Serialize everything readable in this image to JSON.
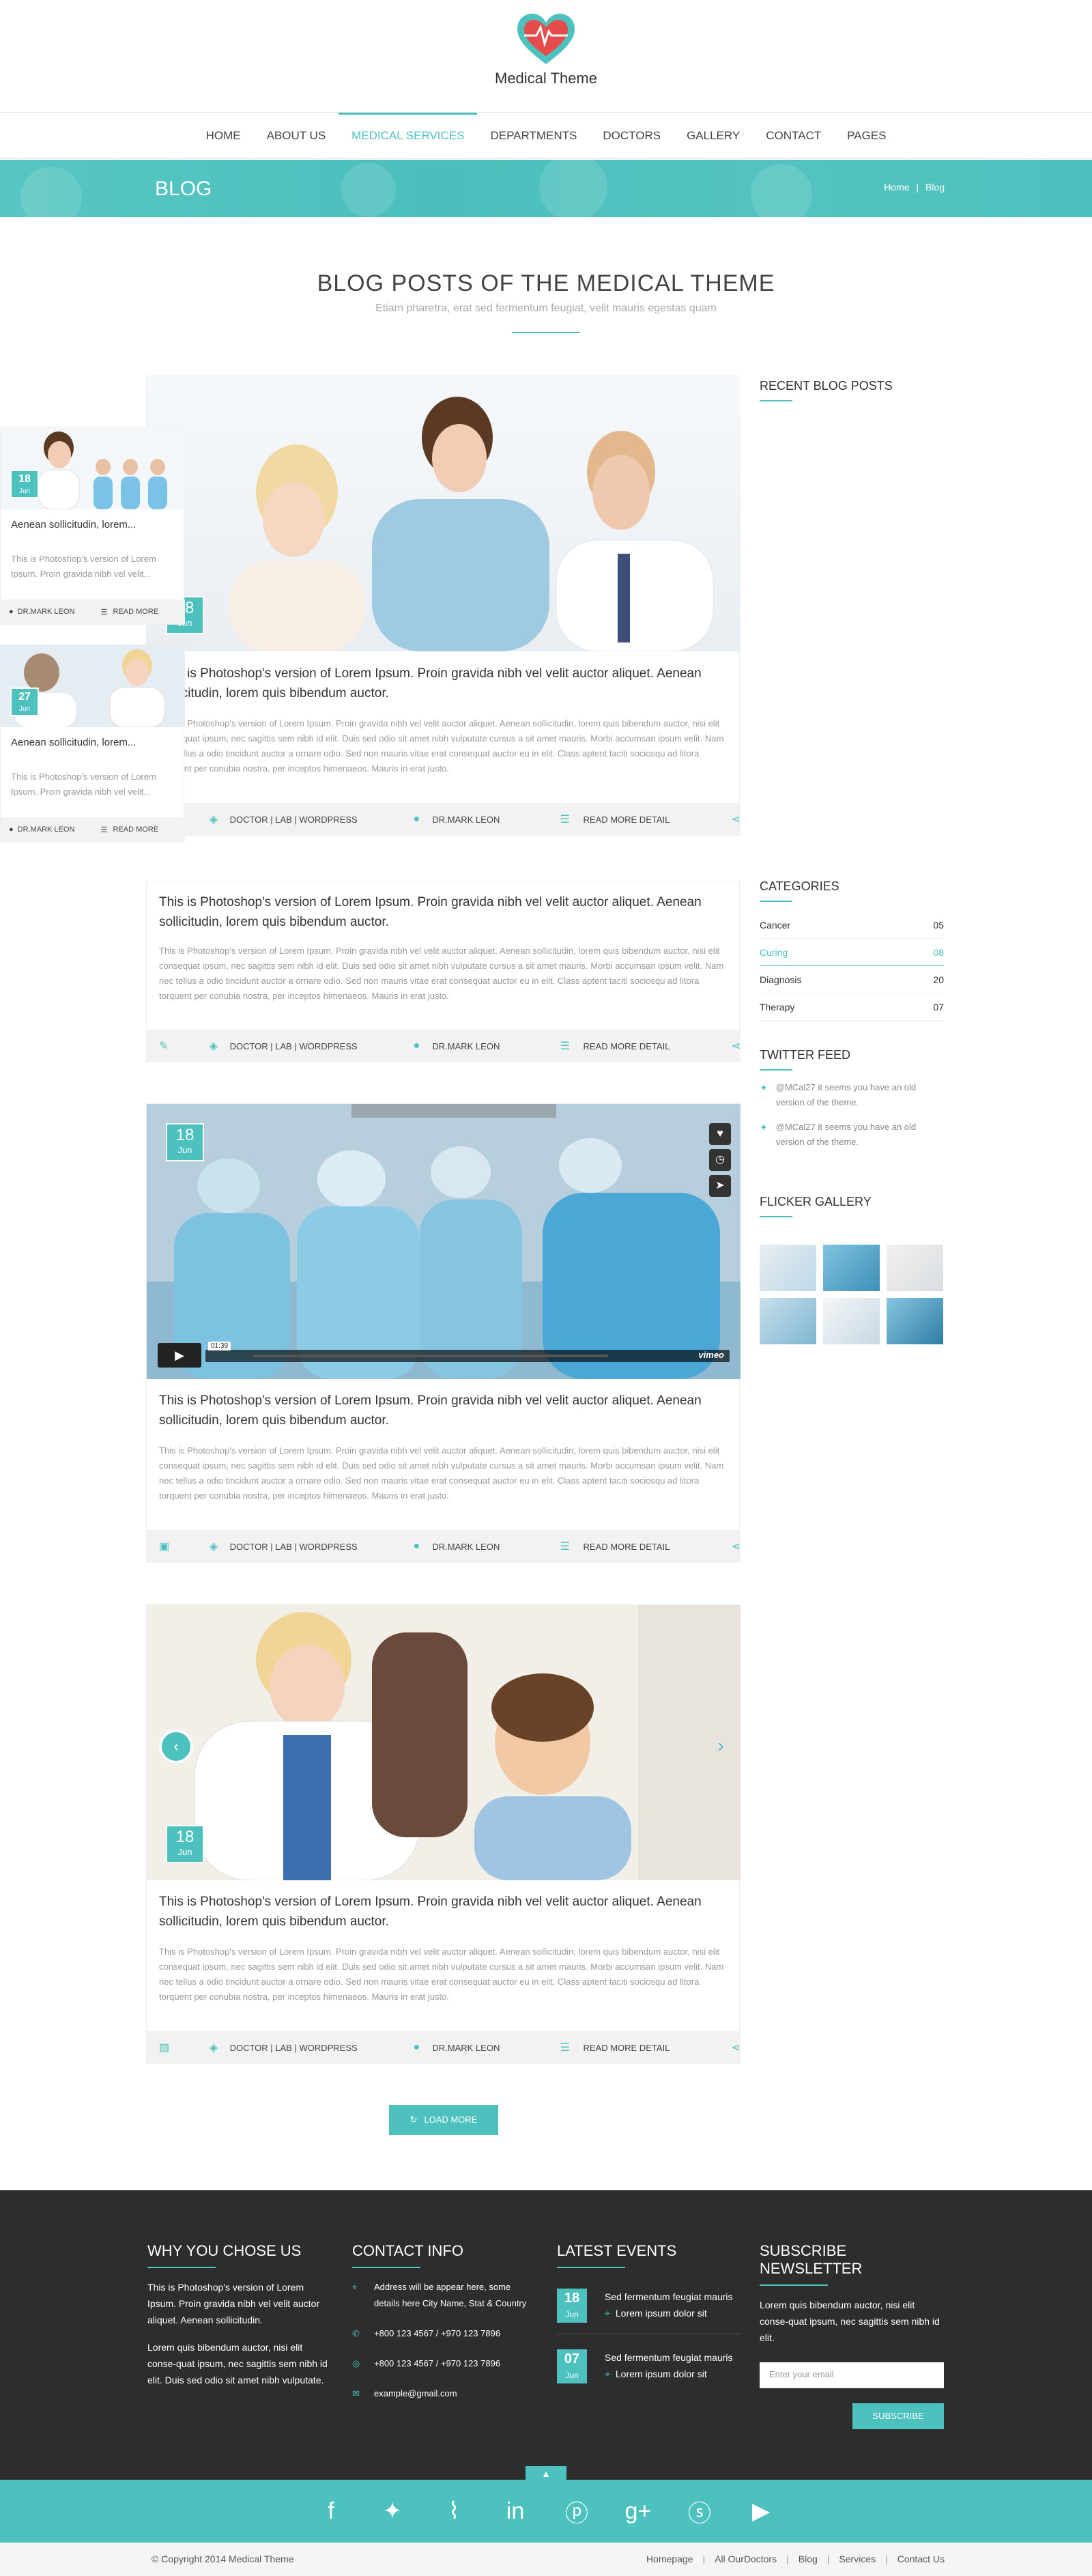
{
  "header": {
    "logo_text": "Medical Theme"
  },
  "nav": {
    "items": [
      "HOME",
      "ABOUT US",
      "MEDICAL SERVICES",
      "DEPARTMENTS",
      "DOCTORS",
      "GALLERY",
      "CONTACT",
      "PAGES"
    ]
  },
  "banner": {
    "title": "BLOG",
    "crumb_home": "Home",
    "crumb_sep": "|",
    "crumb_current": "Blog"
  },
  "section": {
    "title": "BLOG POSTS OF THE MEDICAL THEME",
    "subtitle": "Etiam pharetra, erat sed fermentum feugiat, velit mauris egestas quam"
  },
  "post_common": {
    "title": "This is Photoshop's version  of Lorem Ipsum. Proin gravida nibh vel velit auctor aliquet. Aenean sollicitudin, lorem quis bibendum auctor.",
    "text": "This is Photoshop's version  of Lorem Ipsum. Proin gravida nibh vel velit auctor aliquet. Aenean sollicitudin, lorem quis bibendum auctor, nisi elit consequat ipsum, nec sagittis sem nibh id elit. Duis sed odio sit amet nibh vulputate cursus a sit amet mauris. Morbi accumsan ipsum velit. Nam nec tellus a odio tincidunt auctor a ornare odio. Sed non  mauris vitae erat consequat auctor eu in elit. Class aptent taciti sociosqu ad litora torquent per conubia nostra, per inceptos himenaeos. Mauris in erat justo.",
    "tags": "DOCTOR  |  LAB  |  WORDPRESS",
    "author": "DR.MARK LEON",
    "read_more": "READ MORE DETAIL",
    "day": "18",
    "month": "Jun"
  },
  "video": {
    "time": "01:39",
    "brand": "vimeo"
  },
  "load_more": "LOAD MORE",
  "sidebar": {
    "recent_title": "RECENT BLOG POSTS",
    "recent": [
      {
        "day": "18",
        "month": "Jun",
        "title": "Aenean sollicitudin, lorem...",
        "text": "This is Photoshop's version  of Lorem Ipsum. Proin gravida nibh vel velit...",
        "author": "DR.MARK LEON",
        "read": "READ MORE"
      },
      {
        "day": "27",
        "month": "Jun",
        "title": "Aenean sollicitudin, lorem...",
        "text": "This is Photoshop's version  of Lorem Ipsum. Proin gravida nibh vel velit...",
        "author": "DR.MARK LEON",
        "read": "READ MORE"
      }
    ],
    "categories_title": "CATEGORIES",
    "categories": [
      {
        "name": "Cancer",
        "count": "05"
      },
      {
        "name": "Curing",
        "count": "08"
      },
      {
        "name": "Diagnosis",
        "count": "20"
      },
      {
        "name": "Therapy",
        "count": "07"
      }
    ],
    "twitter_title": "TWITTER FEED",
    "tweets": [
      "@MCal27  it seems you have an old version of the theme.",
      "@MCal27  it seems you have an old version of the theme."
    ],
    "flicker_title": "FLICKER GALLERY"
  },
  "footer": {
    "why_title": "WHY YOU CHOSE US",
    "why_p1": "This is Photoshop's version  of Lorem Ipsum. Proin gravida nibh vel velit auctor aliquet. Aenean sollicitudin.",
    "why_p2": "Lorem quis bibendum auctor, nisi elit conse-quat ipsum, nec sagittis sem nibh id elit. Duis sed odio sit amet nibh vulputate.",
    "contact_title": "CONTACT INFO",
    "address": "Address will be appear here, some details here City Name, Stat & Country",
    "phone": "+800 123 4567  /  +970 123 7896",
    "fax": "+800 123 4567  /  +970 123 7896",
    "email": "example@gmail.com",
    "events_title": "LATEST EVENTS",
    "events": [
      {
        "day": "18",
        "month": "Jun",
        "title": "Sed fermentum feugiat mauris",
        "place": "Lorem ipsum dolor sit"
      },
      {
        "day": "07",
        "month": "Jun",
        "title": "Sed fermentum feugiat mauris",
        "place": "Lorem ipsum dolor sit"
      }
    ],
    "subscribe_title": "SUBSCRIBE NEWSLETTER",
    "subscribe_text": "Lorem quis bibendum auctor, nisi elit conse-quat ipsum, nec sagittis sem nibh id elit.",
    "email_placeholder": "Enter your email",
    "subscribe_btn": "SUBSCRIBE"
  },
  "social_icons": [
    "facebook-icon",
    "twitter-icon",
    "rss-icon",
    "linkedin-icon",
    "pinterest-icon",
    "google-plus-icon",
    "skype-icon",
    "youtube-icon"
  ],
  "bottom": {
    "copyright": "© Copyright 2014 Medical Theme",
    "links": [
      "Homepage",
      "All OurDoctors",
      "Blog",
      "Services",
      "Contact Us"
    ]
  },
  "colors": {
    "accent": "#4cc1bd",
    "footer": "#2d2d2d"
  }
}
